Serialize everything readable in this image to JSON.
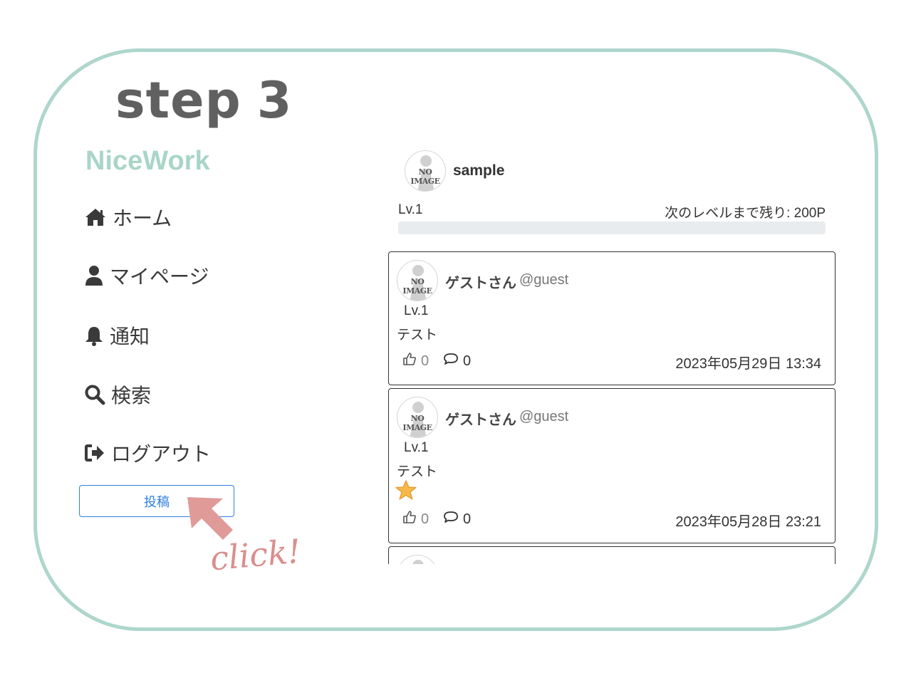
{
  "step": {
    "word": "step",
    "number": "3"
  },
  "brand": "NiceWork",
  "nav": [
    {
      "label": "ホーム",
      "icon": "home-icon"
    },
    {
      "label": "マイページ",
      "icon": "user-icon"
    },
    {
      "label": "通知",
      "icon": "bell-icon"
    },
    {
      "label": "検索",
      "icon": "search-icon"
    },
    {
      "label": "ログアウト",
      "icon": "logout-icon"
    }
  ],
  "post_button": "投稿",
  "annotation": "click!",
  "avatar_text": "NO IMAGE",
  "profile": {
    "name": "sample",
    "level": "Lv.1",
    "next_level": "次のレベルまで残り: 200P",
    "progress": 0
  },
  "posts": [
    {
      "name": "ゲストさん",
      "handle": "@guest",
      "level": "Lv.1",
      "text": "テスト",
      "likes": "0",
      "comments": "0",
      "date": "2023年05月29日 13:34",
      "star": false
    },
    {
      "name": "ゲストさん",
      "handle": "@guest",
      "level": "Lv.1",
      "text": "テスト",
      "likes": "0",
      "comments": "0",
      "date": "2023年05月28日 23:21",
      "star": true
    }
  ],
  "colors": {
    "frame": "#aed6cc",
    "brand": "#a9d5c8",
    "accent": "#2f7fe0",
    "arrow": "#e09a98"
  }
}
